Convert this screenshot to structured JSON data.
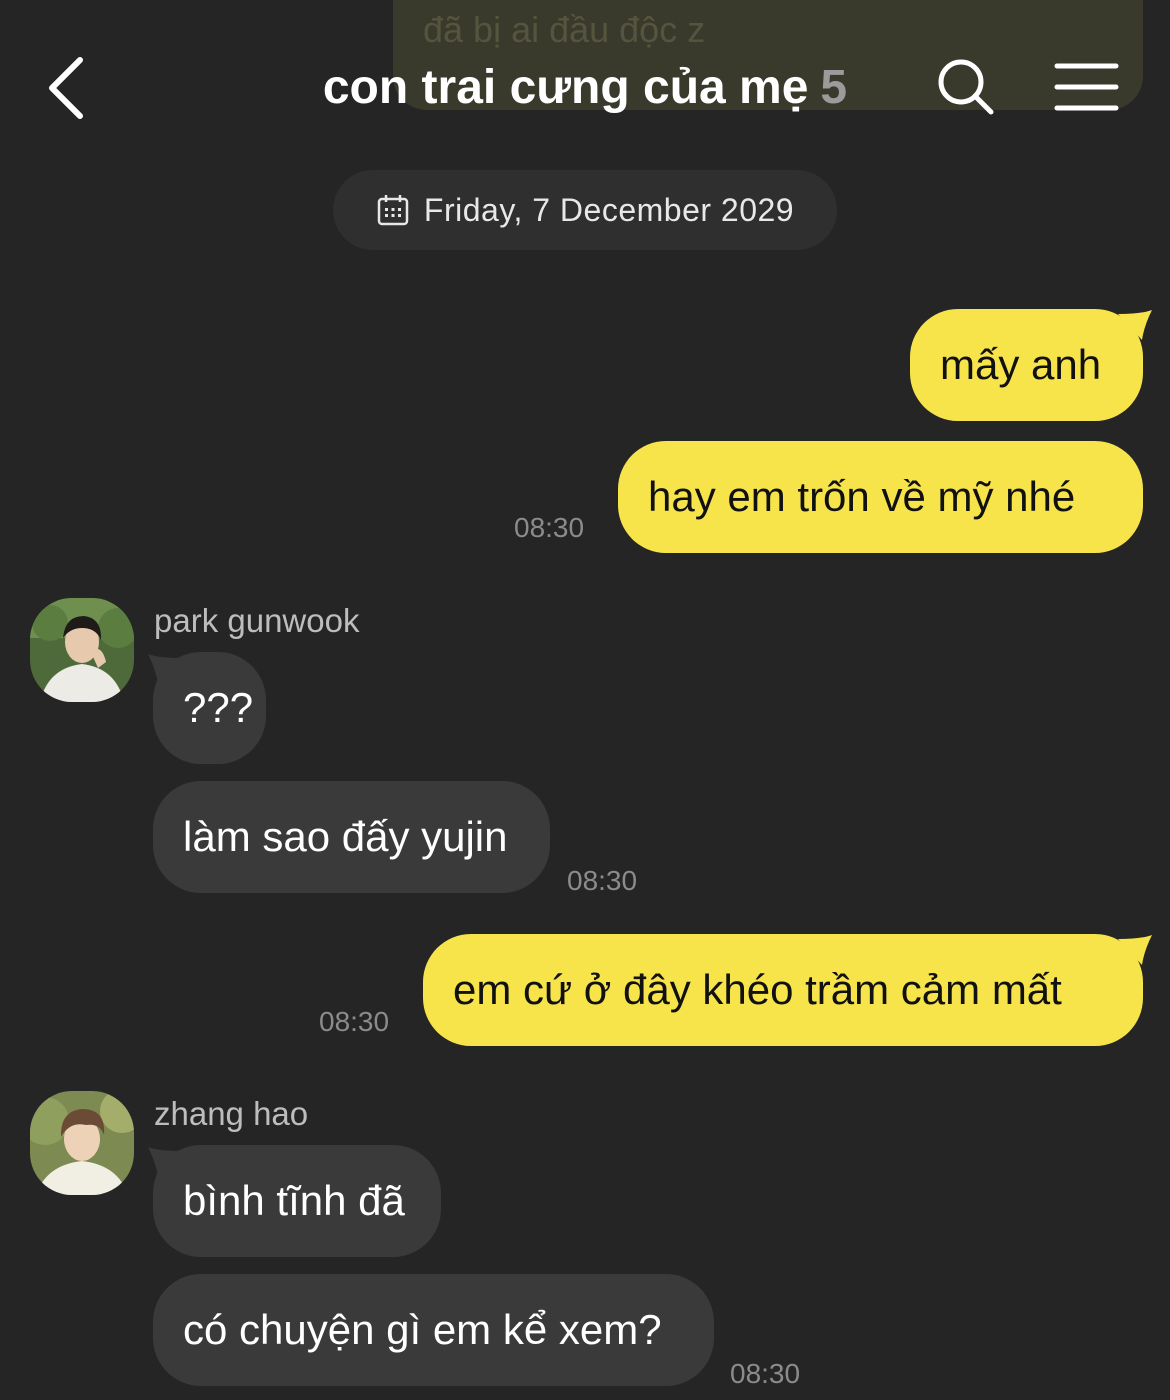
{
  "header": {
    "title": "con trai cưng của mẹ",
    "member_count": "5",
    "previous_message_preview": "mấy năm qua em đi anh matthew\nđã bị ai đầu độc z"
  },
  "date_divider": "Friday, 7 December 2029",
  "messages": [
    {
      "sender": "me",
      "text": "mấy anh"
    },
    {
      "sender": "me",
      "text": "hay em trốn về mỹ nhé",
      "time": "08:30"
    },
    {
      "sender": "park gunwook",
      "text": "???"
    },
    {
      "sender": "park gunwook",
      "text": "làm sao đấy yujin",
      "time": "08:30"
    },
    {
      "sender": "me",
      "text": "em cứ ở đây khéo trầm cảm mất",
      "time": "08:30"
    },
    {
      "sender": "zhang hao",
      "text": "bình tĩnh đã"
    },
    {
      "sender": "zhang hao",
      "text": "có chuyện gì em kể xem?",
      "time": "08:30"
    }
  ],
  "colors": {
    "background": "#252525",
    "my_bubble": "#f7e34a",
    "other_bubble": "#3a3a3a",
    "timestamp": "#8b8b8b"
  },
  "icons": [
    "back-chevron-icon",
    "search-icon",
    "menu-icon",
    "calendar-icon"
  ]
}
